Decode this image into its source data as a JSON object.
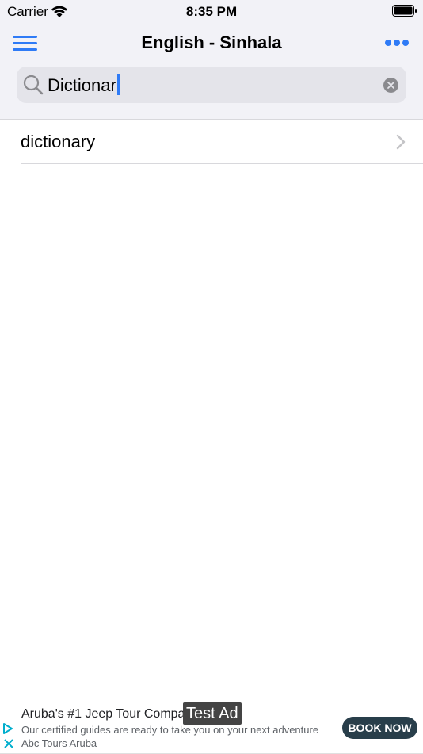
{
  "status_bar": {
    "carrier": "Carrier",
    "time": "8:35 PM",
    "wifi_icon": "wifi-icon",
    "battery_icon": "battery-icon"
  },
  "navbar": {
    "title": "English - Sinhala",
    "menu_icon": "hamburger-menu-icon",
    "more_icon": "more-horizontal-icon",
    "accent_color": "#2f7bf6"
  },
  "search": {
    "value": "Dictionar",
    "search_icon": "search-icon",
    "clear_icon": "clear-icon"
  },
  "results": [
    {
      "label": "dictionary",
      "chevron_icon": "chevron-right-icon"
    }
  ],
  "ad": {
    "badge": "Test Ad",
    "title": "Aruba's #1 Jeep Tour Compar",
    "description": "Our certified guides are ready to take you on your next adventure Abc Tours Aruba",
    "cta": "BOOK NOW",
    "cta_color": "#283e4a"
  }
}
